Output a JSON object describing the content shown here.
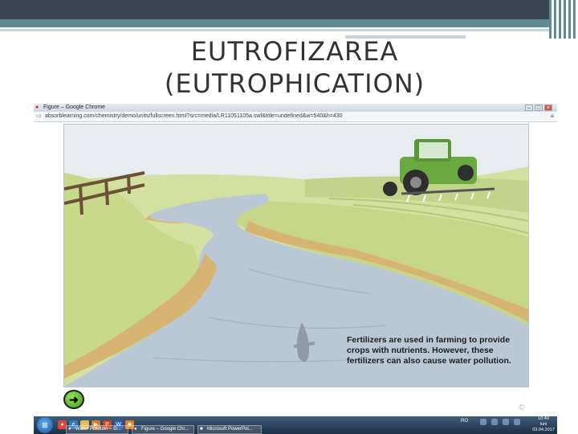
{
  "slide": {
    "title_line1": "EUTROFIZAREA",
    "title_line2": "(EUTROPHICATION)"
  },
  "browser": {
    "window_title": "Figure – Google Chrome",
    "url": "absorblearning.com/chemistry/demo/units/fullscreen.html?src=media/LR11051105a.swf&title=undefined&w=540&h=430",
    "window_controls": [
      "minimize-icon",
      "maximize-icon",
      "close-icon"
    ]
  },
  "scene": {
    "caption": "Fertilizers are used in farming to provide crops with nutrients. However, these fertilizers can also cause water pollution.",
    "next_icon": "arrow-right-icon",
    "copyright": "©",
    "colors": {
      "sky": "#eaeef1",
      "grass": "#c9da8e",
      "grass_dark": "#aec56f",
      "river": "#b8c6d3",
      "bank": "#d8b678",
      "tractor": "#6aa840"
    }
  },
  "taskbar": {
    "start_icon": "windows-start-icon",
    "quick_launch": [
      "chrome-icon",
      "explorer-icon",
      "folder-icon",
      "media-icon",
      "powerpoint-icon",
      "word-icon",
      "firefox-icon"
    ],
    "tasks": [
      {
        "label": "Water Pollution – G...",
        "icon": "chrome-icon"
      },
      {
        "label": "Figure – Google Chr...",
        "icon": "chrome-icon"
      },
      {
        "label": "Microsoft PowerPoi...",
        "icon": "powerpoint-icon"
      }
    ],
    "language": "RO",
    "time": "10:40",
    "day": "luni",
    "date": "03.04.2017"
  }
}
